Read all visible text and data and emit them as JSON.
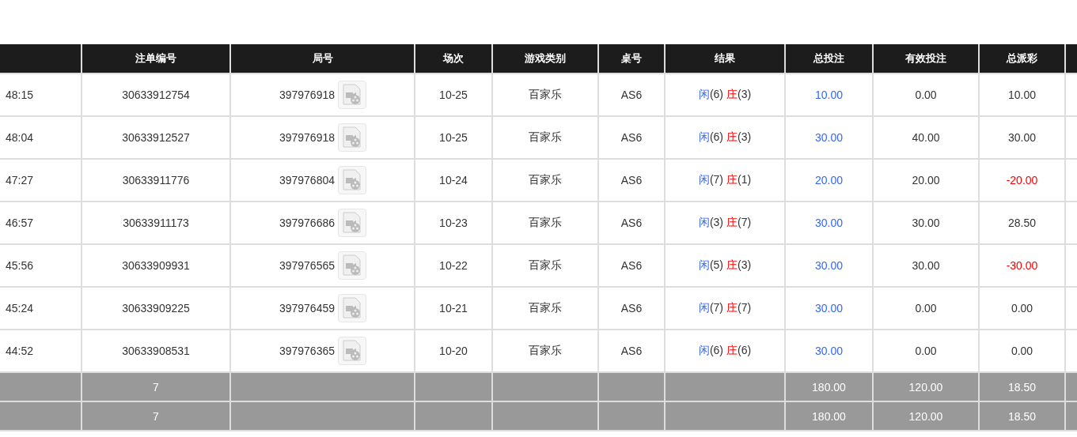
{
  "table": {
    "columns": [
      "",
      "注单编号",
      "局号",
      "场次",
      "游戏类别",
      "桌号",
      "结果",
      "总投注",
      "有效投注",
      "总派彩",
      ""
    ],
    "rows": [
      {
        "time": "48:15",
        "bet_id": "30633912754",
        "round": "397976918",
        "shoe": "10-25",
        "game": "百家乐",
        "table": "AS6",
        "result": [
          {
            "kind": "player",
            "label": "闲",
            "score": "(6)"
          },
          {
            "kind": "banker",
            "label": "庄",
            "score": "(3)"
          }
        ],
        "total_bet": "10.00",
        "valid_bet": "0.00",
        "payout": "10.00",
        "loss": false
      },
      {
        "time": "48:04",
        "bet_id": "30633912527",
        "round": "397976918",
        "shoe": "10-25",
        "game": "百家乐",
        "table": "AS6",
        "result": [
          {
            "kind": "player",
            "label": "闲",
            "score": "(6)"
          },
          {
            "kind": "banker",
            "label": "庄",
            "score": "(3)"
          }
        ],
        "total_bet": "30.00",
        "valid_bet": "40.00",
        "payout": "30.00",
        "loss": false
      },
      {
        "time": "47:27",
        "bet_id": "30633911776",
        "round": "397976804",
        "shoe": "10-24",
        "game": "百家乐",
        "table": "AS6",
        "result": [
          {
            "kind": "player",
            "label": "闲",
            "score": "(7)"
          },
          {
            "kind": "banker",
            "label": "庄",
            "score": "(1)"
          }
        ],
        "total_bet": "20.00",
        "valid_bet": "20.00",
        "payout": "-20.00",
        "loss": true
      },
      {
        "time": "46:57",
        "bet_id": "30633911173",
        "round": "397976686",
        "shoe": "10-23",
        "game": "百家乐",
        "table": "AS6",
        "result": [
          {
            "kind": "player",
            "label": "闲",
            "score": "(3)"
          },
          {
            "kind": "banker",
            "label": "庄",
            "score": "(7)"
          }
        ],
        "total_bet": "30.00",
        "valid_bet": "30.00",
        "payout": "28.50",
        "loss": false
      },
      {
        "time": "45:56",
        "bet_id": "30633909931",
        "round": "397976565",
        "shoe": "10-22",
        "game": "百家乐",
        "table": "AS6",
        "result": [
          {
            "kind": "player",
            "label": "闲",
            "score": "(5)"
          },
          {
            "kind": "banker",
            "label": "庄",
            "score": "(3)"
          }
        ],
        "total_bet": "30.00",
        "valid_bet": "30.00",
        "payout": "-30.00",
        "loss": true
      },
      {
        "time": "45:24",
        "bet_id": "30633909225",
        "round": "397976459",
        "shoe": "10-21",
        "game": "百家乐",
        "table": "AS6",
        "result": [
          {
            "kind": "player",
            "label": "闲",
            "score": "(7)"
          },
          {
            "kind": "banker",
            "label": "庄",
            "score": "(7)"
          }
        ],
        "total_bet": "30.00",
        "valid_bet": "0.00",
        "payout": "0.00",
        "loss": false
      },
      {
        "time": "44:52",
        "bet_id": "30633908531",
        "round": "397976365",
        "shoe": "10-20",
        "game": "百家乐",
        "table": "AS6",
        "result": [
          {
            "kind": "player",
            "label": "闲",
            "score": "(6)"
          },
          {
            "kind": "banker",
            "label": "庄",
            "score": "(6)"
          }
        ],
        "total_bet": "30.00",
        "valid_bet": "0.00",
        "payout": "0.00",
        "loss": false
      }
    ],
    "totals": [
      {
        "count": "7",
        "total_bet": "180.00",
        "valid_bet": "120.00",
        "payout": "18.50"
      },
      {
        "count": "7",
        "total_bet": "180.00",
        "valid_bet": "120.00",
        "payout": "18.50"
      }
    ]
  }
}
